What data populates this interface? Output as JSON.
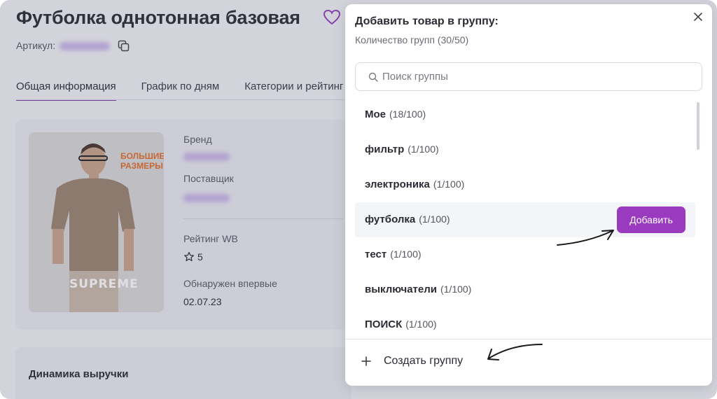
{
  "product": {
    "title": "Футболка однотонная базовая",
    "sku_label": "Артикул:"
  },
  "tabs": [
    {
      "label": "Общая информация",
      "active": true
    },
    {
      "label": "График по дням",
      "active": false
    },
    {
      "label": "Категории и рейтинг",
      "active": false
    }
  ],
  "info": {
    "brand_label": "Бренд",
    "supplier_label": "Поставщик",
    "rating_label": "Рейтинг WB",
    "rating_value": "5",
    "first_seen_label": "Обнаружен впервые",
    "first_seen_value": "02.07.23"
  },
  "image": {
    "banner": "БОЛЬШИЕ РАЗМЕРЫ",
    "brand_text": "SUPREME"
  },
  "revenue": {
    "title": "Динамика выручки"
  },
  "modal": {
    "title": "Добавить товар в группу:",
    "subtitle": "Количество групп (30/50)",
    "search_placeholder": "Поиск группы",
    "groups": [
      {
        "name": "Мое",
        "count": "(18/100)"
      },
      {
        "name": "фильтр",
        "count": "(1/100)"
      },
      {
        "name": "электроника",
        "count": "(1/100)"
      },
      {
        "name": "футболка",
        "count": "(1/100)",
        "hovered": true
      },
      {
        "name": "тест",
        "count": "(1/100)"
      },
      {
        "name": "выключатели",
        "count": "(1/100)"
      },
      {
        "name": "ПОИСК",
        "count": "(1/100)"
      }
    ],
    "add_button": "Добавить",
    "create_group": "Создать группу"
  },
  "colors": {
    "accent": "#9a3bbf",
    "tab_underline": "#7b3fa8",
    "heart": "#8e44b5"
  },
  "icons": [
    "heart-icon",
    "copy-icon",
    "star-icon",
    "close-icon",
    "search-icon",
    "plus-icon"
  ]
}
